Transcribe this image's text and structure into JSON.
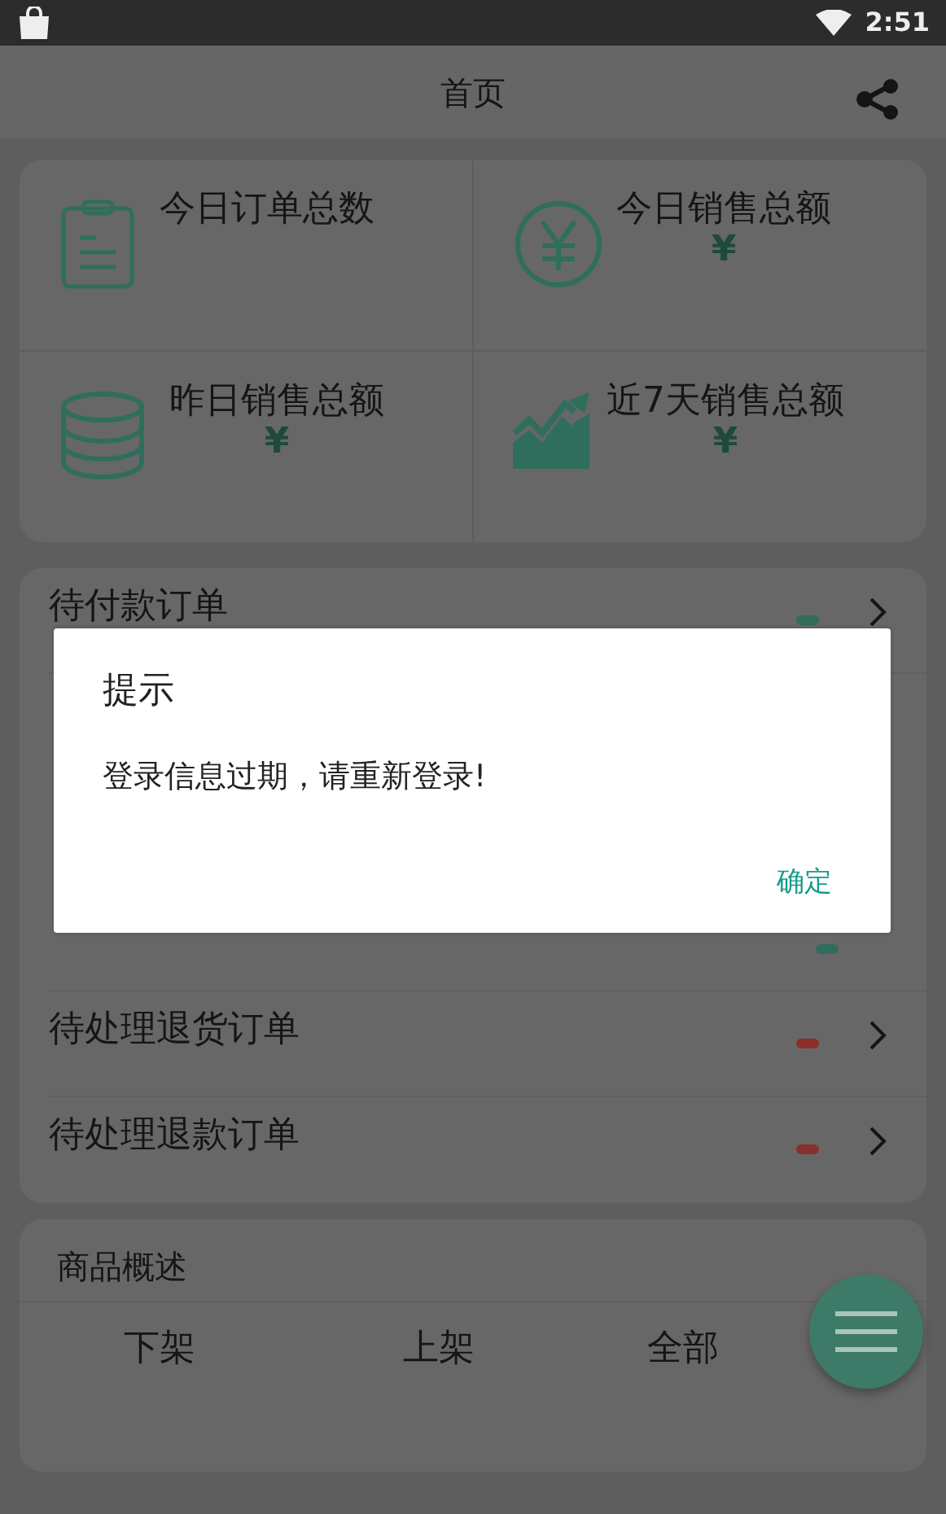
{
  "status_bar": {
    "time": "2:51"
  },
  "header": {
    "title": "首页"
  },
  "stats": [
    {
      "kind": "clipboard",
      "title": "今日订单总数"
    },
    {
      "kind": "yuan",
      "title": "今日销售总额",
      "value": "¥"
    },
    {
      "kind": "coins",
      "title": "昨日销售总额",
      "value": "¥"
    },
    {
      "kind": "trend",
      "title": "近7天销售总额",
      "value": "¥"
    }
  ],
  "orders": [
    {
      "label": "待付款订单",
      "color": "#2f6e5c"
    },
    {
      "covered": true,
      "color": "#2f6e5c"
    },
    {
      "label": "待处理退货订单",
      "color": "#8a2f2b"
    },
    {
      "label": "待处理退款订单",
      "color": "#8a2f2b"
    }
  ],
  "products": {
    "title": "商品概述",
    "columns": [
      "下架",
      "上架",
      "全部"
    ]
  },
  "dialog": {
    "title": "提示",
    "message": "登录信息过期，请重新登录!",
    "button": "确定"
  }
}
